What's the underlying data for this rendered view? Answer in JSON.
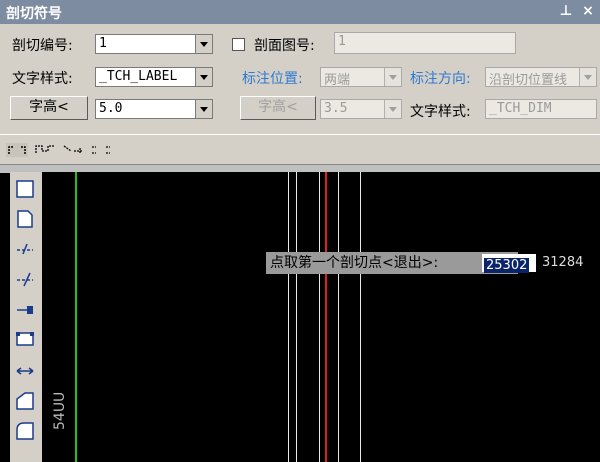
{
  "window": {
    "title": "剖切符号",
    "pin_icon": "pin-icon",
    "close_icon": "close-icon"
  },
  "form": {
    "section_number_label": "剖切编号:",
    "section_number_value": "1",
    "section_view_checkbox_label": "剖面图号:",
    "section_view_value": "1",
    "text_style_label": "文字样式:",
    "text_style_value": "_TCH_LABEL",
    "text_height_button": "字高<",
    "text_height_value": "5.0",
    "annotation_position_label": "标注位置:",
    "annotation_position_value": "两端",
    "annotation_direction_label": "标注方向:",
    "annotation_direction_value": "沿剖切位置线",
    "text_height_button_2": "字高<",
    "text_height_value_2": "3.5",
    "text_style_label_2": "文字样式:",
    "text_style_value_2": "_TCH_DIM"
  },
  "canvas": {
    "prompt": "点取第一个剖切点<退出>:",
    "coord_x": "25302",
    "coord_y": "31284",
    "side_text": "54UU"
  },
  "colors": {
    "accent_blue": "#2e7ad1",
    "red_line": "#e02020",
    "green_line": "#20c020"
  }
}
